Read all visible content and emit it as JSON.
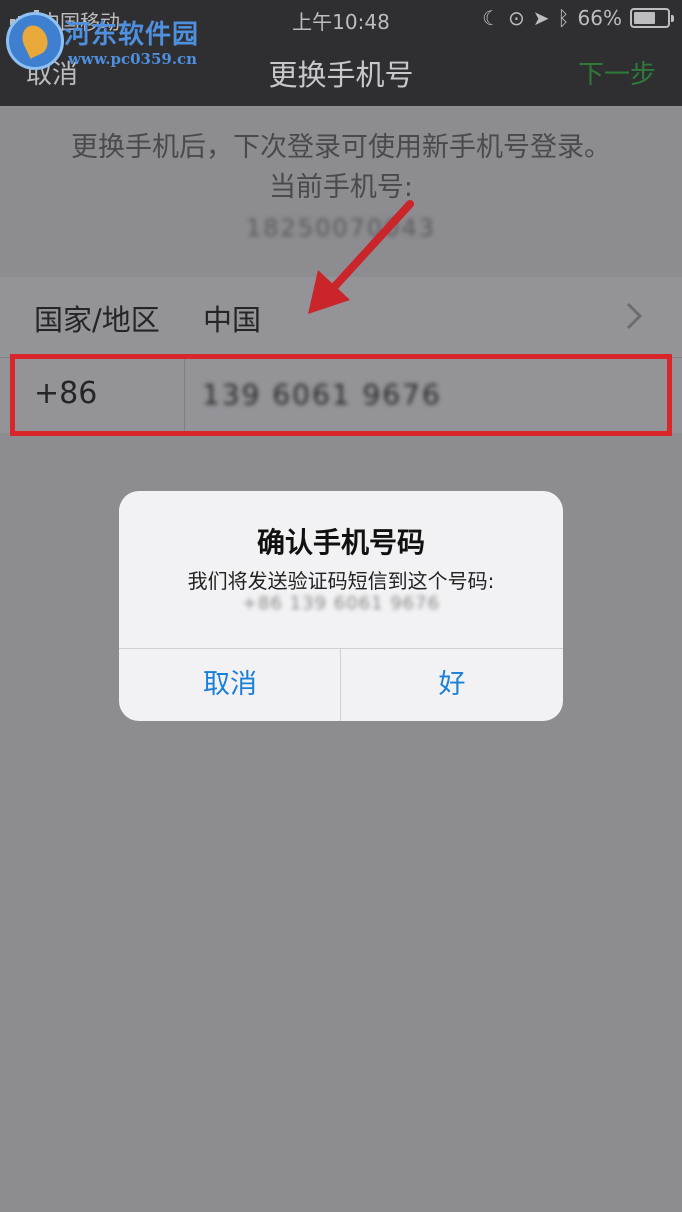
{
  "status": {
    "carrier": "中国移动",
    "time": "上午10:48",
    "battery": "66%",
    "battery_level": 0.66
  },
  "nav": {
    "cancel_label": "取消",
    "title": "更换手机号",
    "next_label": "下一步"
  },
  "watermark": {
    "title": "河东软件园",
    "url": "www.pc0359.cn"
  },
  "info": {
    "line1": "更换手机后，下次登录可使用新手机号登录。",
    "line2": "当前手机号:",
    "current_number": "18250070043"
  },
  "country_row": {
    "label": "国家/地区",
    "value": "中国"
  },
  "phone_row": {
    "code": "+86",
    "number": "139 6061 9676"
  },
  "dialog": {
    "title": "确认手机号码",
    "message": "我们将发送验证码短信到这个号码:",
    "number": "+86 139 6061 9676",
    "cancel_label": "取消",
    "ok_label": "好"
  },
  "colors": {
    "accent_blue": "#1a7fd8",
    "next_green": "#2f7a39",
    "highlight_red": "#d8262b"
  }
}
